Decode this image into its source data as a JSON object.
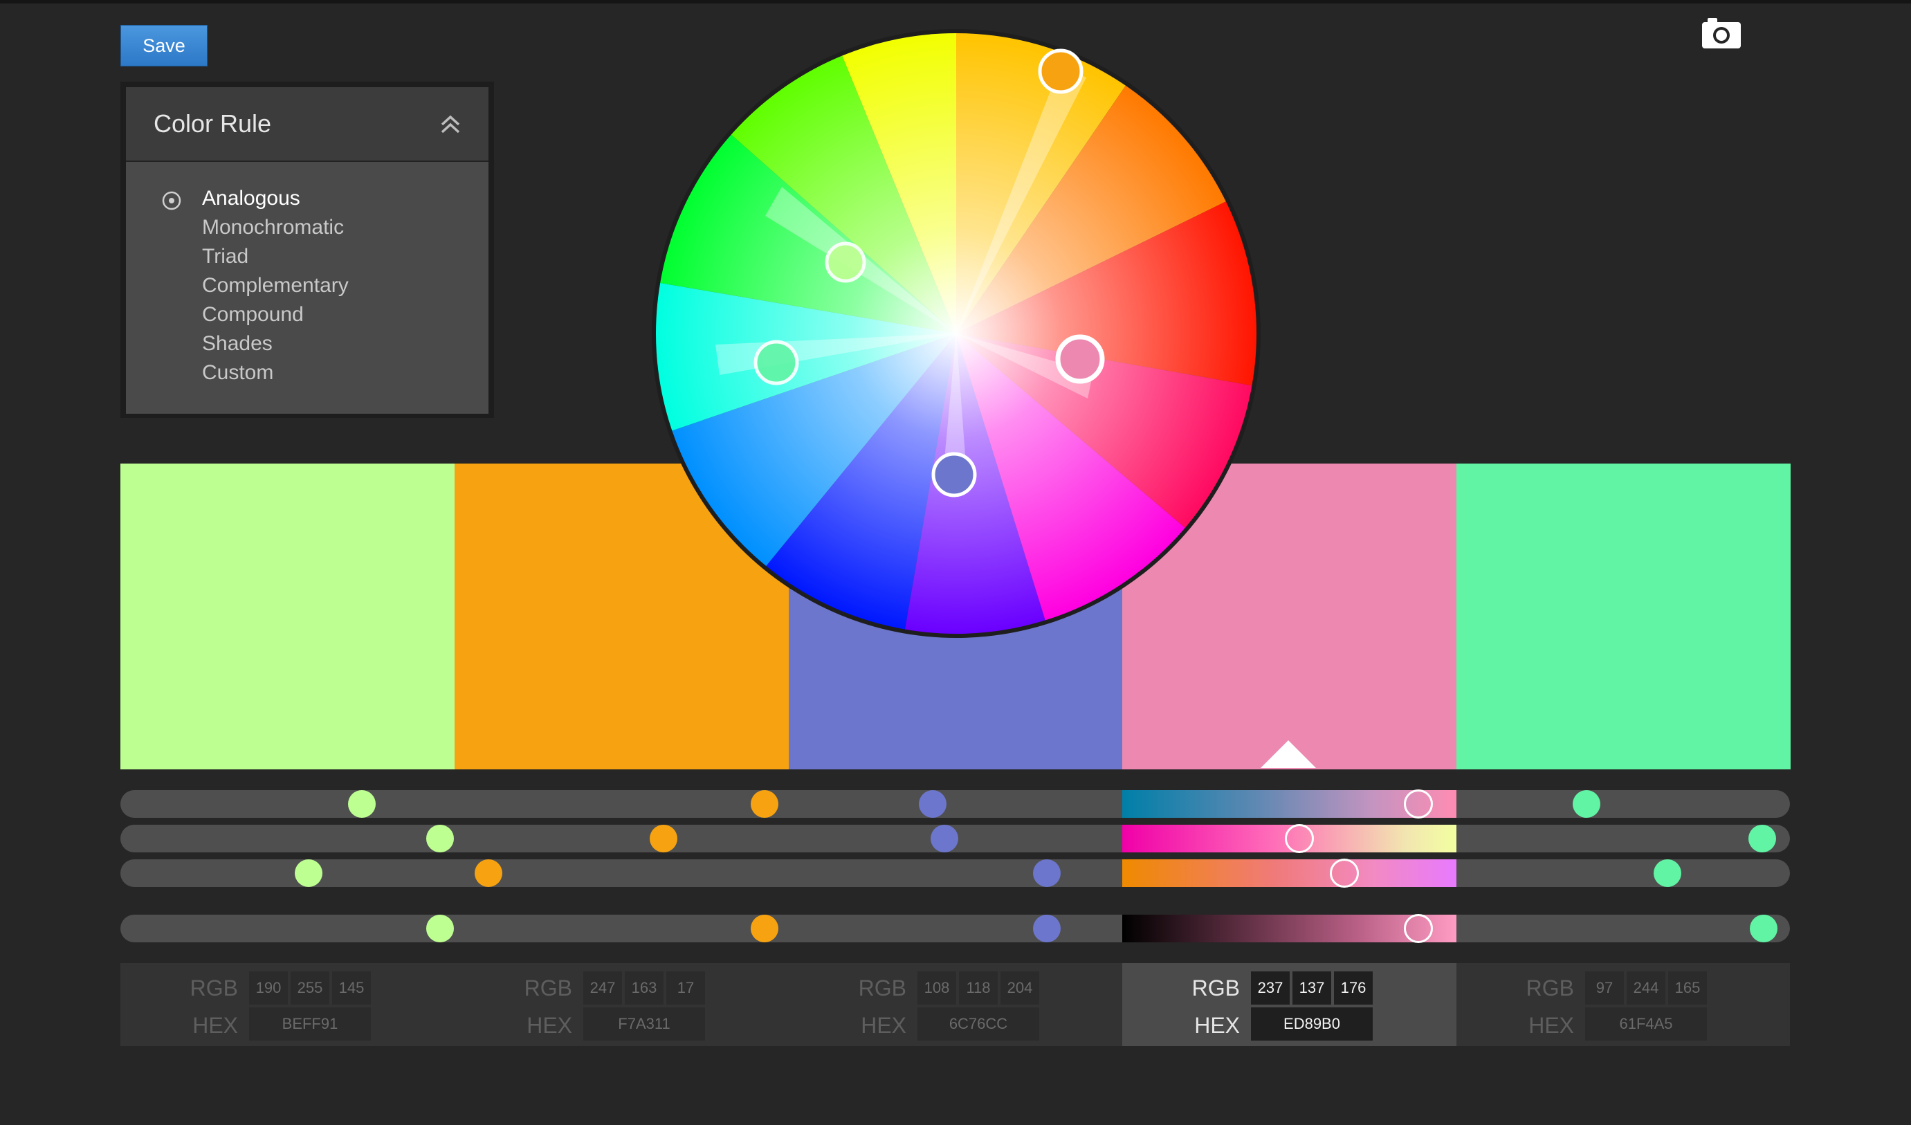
{
  "toolbar": {
    "save_label": "Save",
    "camera_icon": "camera-icon"
  },
  "color_rule": {
    "title": "Color Rule",
    "options": [
      "Analogous",
      "Monochromatic",
      "Triad",
      "Complementary",
      "Compound",
      "Shades",
      "Custom"
    ],
    "selected": "Analogous"
  },
  "swatches": [
    {
      "hex": "BEFF91",
      "color": "#BEFF91",
      "rgb": [
        "190",
        "255",
        "145"
      ]
    },
    {
      "hex": "F7A311",
      "color": "#F7A311",
      "rgb": [
        "247",
        "163",
        "17"
      ]
    },
    {
      "hex": "6C76CC",
      "color": "#6C76CC",
      "rgb": [
        "108",
        "118",
        "204"
      ]
    },
    {
      "hex": "ED89B0",
      "color": "#ED89B0",
      "rgb": [
        "237",
        "137",
        "176"
      ]
    },
    {
      "hex": "61F4A5",
      "color": "#61F4A5",
      "rgb": [
        "97",
        "244",
        "165"
      ]
    }
  ],
  "selected_swatch": 3,
  "labels": {
    "rgb": "RGB",
    "hex": "HEX"
  }
}
